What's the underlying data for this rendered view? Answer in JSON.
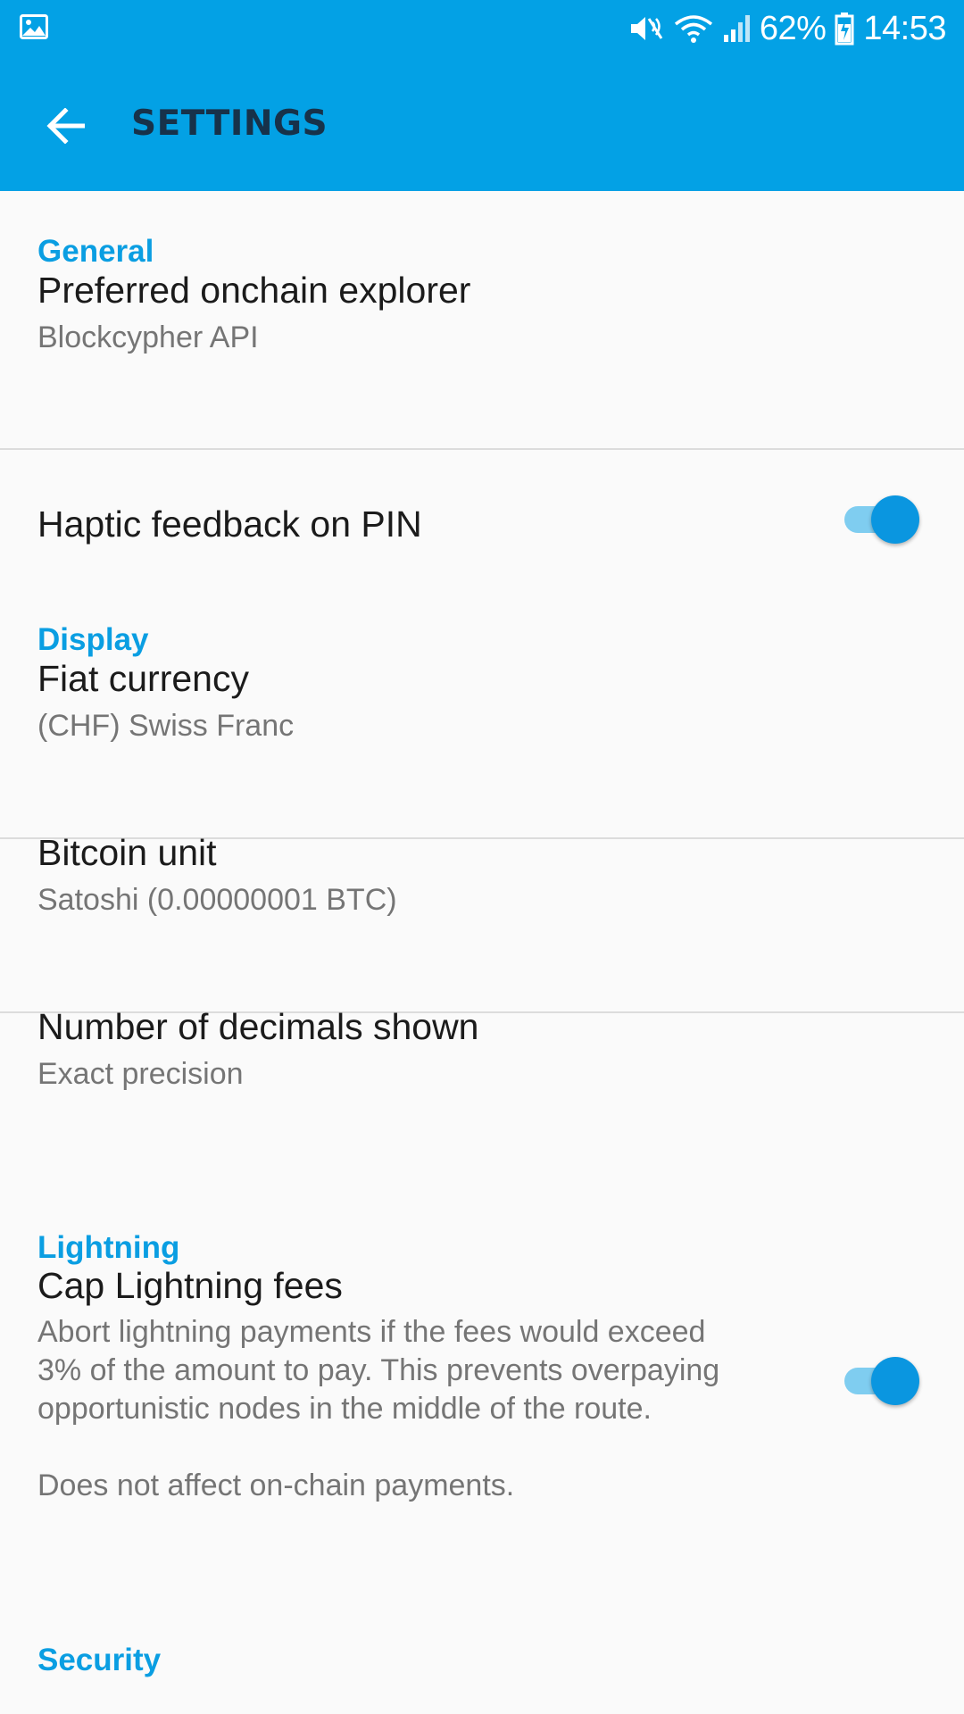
{
  "status_bar": {
    "battery": "62%",
    "time": "14:53",
    "icons": [
      "gallery-icon",
      "mute-icon",
      "wifi-icon",
      "signal-icon",
      "battery-charging-icon"
    ]
  },
  "app_bar": {
    "title": "SETTINGS",
    "back_icon": "arrow-back-icon"
  },
  "colors": {
    "primary": "#03a1e5",
    "accent": "#0a9ee2",
    "switch_thumb": "#0a96e0",
    "switch_track": "#7fcdf0"
  },
  "sections": {
    "general": {
      "header": "General",
      "explorer": {
        "title": "Preferred onchain explorer",
        "summary": "Blockcypher API"
      },
      "haptic": {
        "title": "Haptic feedback on PIN",
        "enabled": true
      }
    },
    "display": {
      "header": "Display",
      "fiat": {
        "title": "Fiat currency",
        "summary": "(CHF) Swiss Franc"
      },
      "unit": {
        "title": "Bitcoin unit",
        "summary": "Satoshi (0.00000001 BTC)"
      },
      "decimals": {
        "title": "Number of decimals shown",
        "summary": "Exact precision"
      }
    },
    "lightning": {
      "header": "Lightning",
      "cap_fees": {
        "title": "Cap Lightning fees",
        "summary_line1": "Abort lightning payments if the fees would exceed",
        "summary_line2": "3% of the amount to pay. This prevents overpaying",
        "summary_line3": "opportunistic nodes in the middle of the route.",
        "summary_line4": "Does not affect on-chain payments.",
        "enabled": true
      }
    },
    "security": {
      "header": "Security"
    }
  }
}
